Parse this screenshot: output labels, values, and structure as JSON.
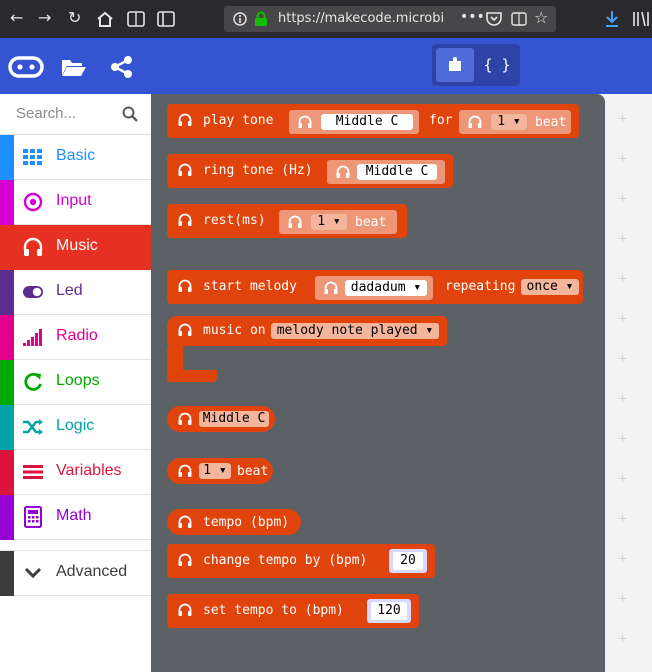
{
  "browser": {
    "url": "https://makecode.microbi",
    "url_dots": "•••"
  },
  "header": {
    "toggle_js": "{ }"
  },
  "toolbox": {
    "search_placeholder": "Search...",
    "categories": [
      {
        "label": "Basic",
        "color": "#1e90ff"
      },
      {
        "label": "Input",
        "color": "#d400d4"
      },
      {
        "label": "Music",
        "color": "#e63022"
      },
      {
        "label": "Led",
        "color": "#5c2d91"
      },
      {
        "label": "Radio",
        "color": "#e3008c"
      },
      {
        "label": "Loops",
        "color": "#00aa00"
      },
      {
        "label": "Logic",
        "color": "#00a4a6"
      },
      {
        "label": "Variables",
        "color": "#dc143c"
      },
      {
        "label": "Math",
        "color": "#9400d3"
      },
      {
        "label": "Advanced",
        "color": "#3c3c3c"
      }
    ]
  },
  "blocks": {
    "play_tone": {
      "label": "play tone",
      "note": "Middle C",
      "for": "for",
      "beat_value": "1",
      "beat": "beat"
    },
    "ring_tone": {
      "label": "ring tone (Hz)",
      "note": "Middle C"
    },
    "rest": {
      "label": "rest(ms)",
      "beat_value": "1",
      "beat": "beat"
    },
    "start_melody": {
      "label": "start melody",
      "melody": "dadadum",
      "repeating": "repeating",
      "mode": "once"
    },
    "music_on": {
      "label": "music on",
      "event": "melody note played"
    },
    "note_value": {
      "note": "Middle C"
    },
    "beat_value": {
      "value": "1",
      "beat": "beat"
    },
    "tempo": {
      "label": "tempo (bpm)"
    },
    "change_tempo": {
      "label": "change tempo by (bpm)",
      "value": "20"
    },
    "set_tempo": {
      "label": "set tempo to (bpm)",
      "value": "120"
    }
  }
}
